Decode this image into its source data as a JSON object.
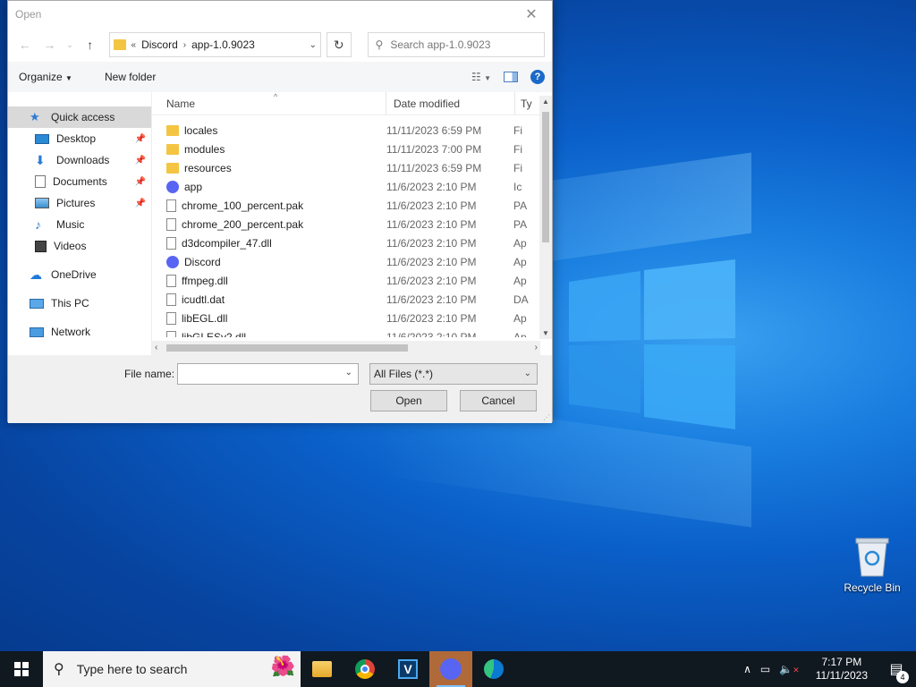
{
  "dialog": {
    "title": "Open",
    "address": {
      "crumbs": [
        "Discord",
        "app-1.0.9023"
      ],
      "overflow": "«"
    },
    "search_placeholder": "Search app-1.0.9023",
    "toolbar": {
      "organize": "Organize",
      "new_folder": "New folder"
    },
    "nav": {
      "quick_access": "Quick access",
      "items": [
        {
          "label": "Desktop",
          "pinned": true
        },
        {
          "label": "Downloads",
          "pinned": true
        },
        {
          "label": "Documents",
          "pinned": true
        },
        {
          "label": "Pictures",
          "pinned": true
        },
        {
          "label": "Music",
          "pinned": false
        },
        {
          "label": "Videos",
          "pinned": false
        }
      ],
      "onedrive": "OneDrive",
      "this_pc": "This PC",
      "network": "Network"
    },
    "columns": {
      "name": "Name",
      "date": "Date modified",
      "type": "Ty"
    },
    "files": [
      {
        "name": "locales",
        "date": "11/11/2023 6:59 PM",
        "type": "Fi",
        "icon": "folder"
      },
      {
        "name": "modules",
        "date": "11/11/2023 7:00 PM",
        "type": "Fi",
        "icon": "folder"
      },
      {
        "name": "resources",
        "date": "11/11/2023 6:59 PM",
        "type": "Fi",
        "icon": "folder"
      },
      {
        "name": "app",
        "date": "11/6/2023 2:10 PM",
        "type": "Ic",
        "icon": "discord"
      },
      {
        "name": "chrome_100_percent.pak",
        "date": "11/6/2023 2:10 PM",
        "type": "PA",
        "icon": "file"
      },
      {
        "name": "chrome_200_percent.pak",
        "date": "11/6/2023 2:10 PM",
        "type": "PA",
        "icon": "file"
      },
      {
        "name": "d3dcompiler_47.dll",
        "date": "11/6/2023 2:10 PM",
        "type": "Ap",
        "icon": "dll"
      },
      {
        "name": "Discord",
        "date": "11/6/2023 2:10 PM",
        "type": "Ap",
        "icon": "discord"
      },
      {
        "name": "ffmpeg.dll",
        "date": "11/6/2023 2:10 PM",
        "type": "Ap",
        "icon": "dll"
      },
      {
        "name": "icudtl.dat",
        "date": "11/6/2023 2:10 PM",
        "type": "DA",
        "icon": "file"
      },
      {
        "name": "libEGL.dll",
        "date": "11/6/2023 2:10 PM",
        "type": "Ap",
        "icon": "dll"
      },
      {
        "name": "libGLESv2.dll",
        "date": "11/6/2023 2:10 PM",
        "type": "Ap",
        "icon": "dll"
      }
    ],
    "file_name_label": "File name:",
    "file_name_value": "",
    "file_type": "All Files (*.*)",
    "open_label": "Open",
    "cancel_label": "Cancel"
  },
  "desktop": {
    "recycle_bin": "Recycle Bin"
  },
  "taskbar": {
    "search_placeholder": "Type here to search",
    "time": "7:17 PM",
    "date": "11/11/2023",
    "notification_count": "4"
  }
}
